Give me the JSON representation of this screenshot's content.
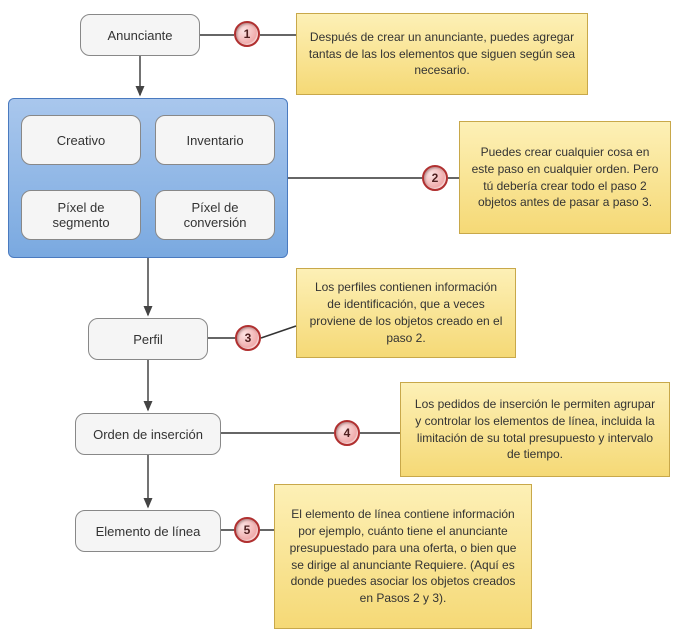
{
  "nodes": {
    "advertiser": "Anunciante",
    "creative": "Creativo",
    "inventory": "Inventario",
    "segment_pixel": "Píxel de segmento",
    "conversion_pixel": "Píxel de conversión",
    "profile": "Perfil",
    "insertion_order": "Orden de inserción",
    "line_item": "Elemento de línea"
  },
  "badges": {
    "b1": "1",
    "b2": "2",
    "b3": "3",
    "b4": "4",
    "b5": "5"
  },
  "notes": {
    "n1": "Después de crear un anunciante, puedes agregar tantas de las los elementos que siguen según sea necesario.",
    "n2": "Puedes crear cualquier cosa en este paso en cualquier orden. Pero tú debería crear todo el paso 2 objetos antes de pasar a paso 3.",
    "n3": "Los perfiles contienen información de identificación, que a veces proviene de los objetos creado en el paso 2.",
    "n4": "Los pedidos de inserción le permiten agrupar y controlar los elementos de línea, incluida la limitación de su total presupuesto y intervalo de tiempo.",
    "n5": "El elemento de línea contiene información por ejemplo, cuánto tiene el anunciante presupuestado para una oferta, o bien que se dirige al anunciante Requiere. (Aquí es donde puedes asociar los objetos creados en Pasos 2 y 3)."
  }
}
